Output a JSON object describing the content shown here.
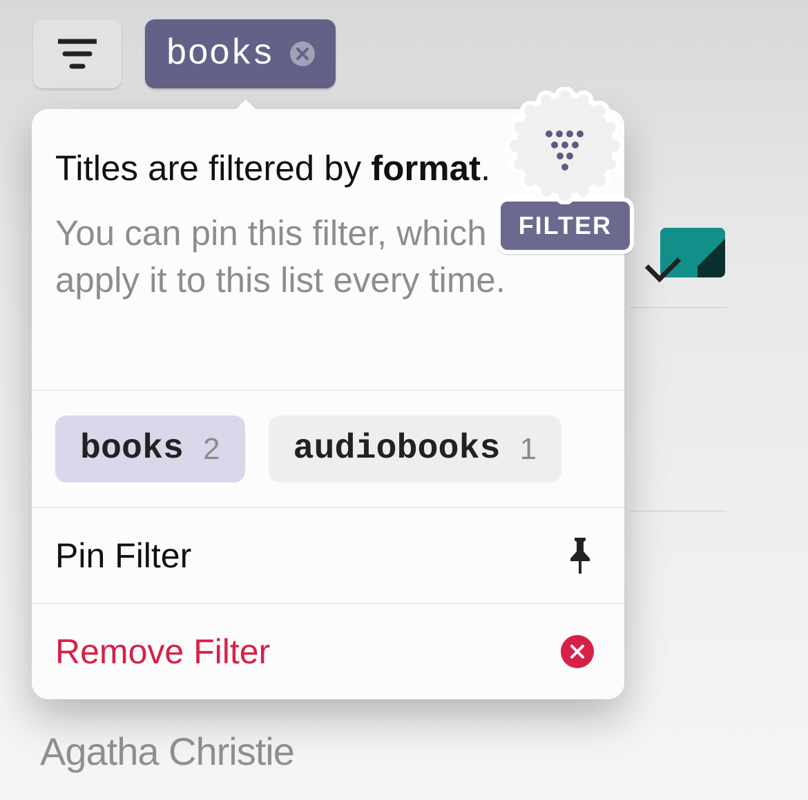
{
  "topbar": {
    "active_filter_label": "books"
  },
  "popover": {
    "title_prefix": "Titles are filtered by ",
    "title_strong": "format",
    "title_suffix": ".",
    "description": "You can pin this filter, which will apply it to this list every time.",
    "options": [
      {
        "label": "books",
        "count": "2",
        "selected": true
      },
      {
        "label": "audiobooks",
        "count": "1",
        "selected": false
      }
    ],
    "pin_label": "Pin Filter",
    "remove_label": "Remove Filter"
  },
  "filter_badge": {
    "label": "FILTER"
  },
  "background": {
    "author_truncated": "Agatha Christie"
  }
}
